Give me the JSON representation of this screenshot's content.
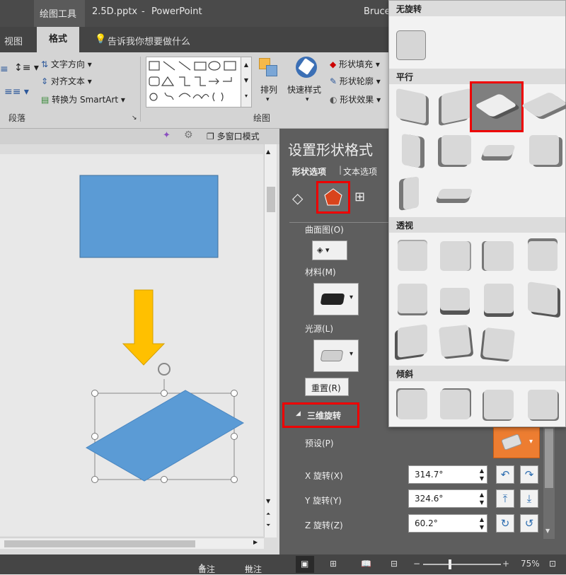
{
  "titlebar": {
    "context_tab": "绘图工具",
    "filename": "2.5D.pptx",
    "separator": "-",
    "app": "PowerPoint",
    "user": "Bruce"
  },
  "tabs": {
    "view": "视图",
    "format": "格式",
    "tell_me": "告诉我你想要做什么"
  },
  "ribbon": {
    "text_direction": "文字方向 ▾",
    "align_text": "对齐文本 ▾",
    "convert_smartart": "转换为 SmartArt ▾",
    "paragraph_group": "段落",
    "arrange": "排列",
    "quick_styles": "快速样式",
    "drawing_group": "绘图",
    "shape_fill": "形状填充 ▾",
    "shape_outline": "形状轮廓 ▾",
    "shape_effects": "形状效果 ▾"
  },
  "toolbar2": {
    "multi_window": "多窗口模式"
  },
  "panel": {
    "title": "设置形状格式",
    "tab_shape": "形状选项",
    "tab_text": "文本选项",
    "contour": "曲面图(O)",
    "material": "材料(M)",
    "lighting": "光源(L)",
    "reset": "重置(R)",
    "section_3d": "三维旋转",
    "preset": "预设(P)",
    "x_label": "X 旋转(X)",
    "x_value": "314.7°",
    "y_label": "Y 旋转(Y)",
    "y_value": "324.6°",
    "z_label": "Z 旋转(Z)",
    "z_value": "60.2°"
  },
  "dropdown": {
    "no_rotation": "无旋转",
    "parallel": "平行",
    "perspective": "透视",
    "oblique": "倾斜"
  },
  "status": {
    "notes": "备注",
    "comments": "批注",
    "zoom": "75%"
  },
  "colors": {
    "accent_red": "#e00000",
    "shape_blue": "#5b9bd5",
    "arrow_yellow": "#ffc000",
    "preset_orange": "#ed7d31"
  }
}
